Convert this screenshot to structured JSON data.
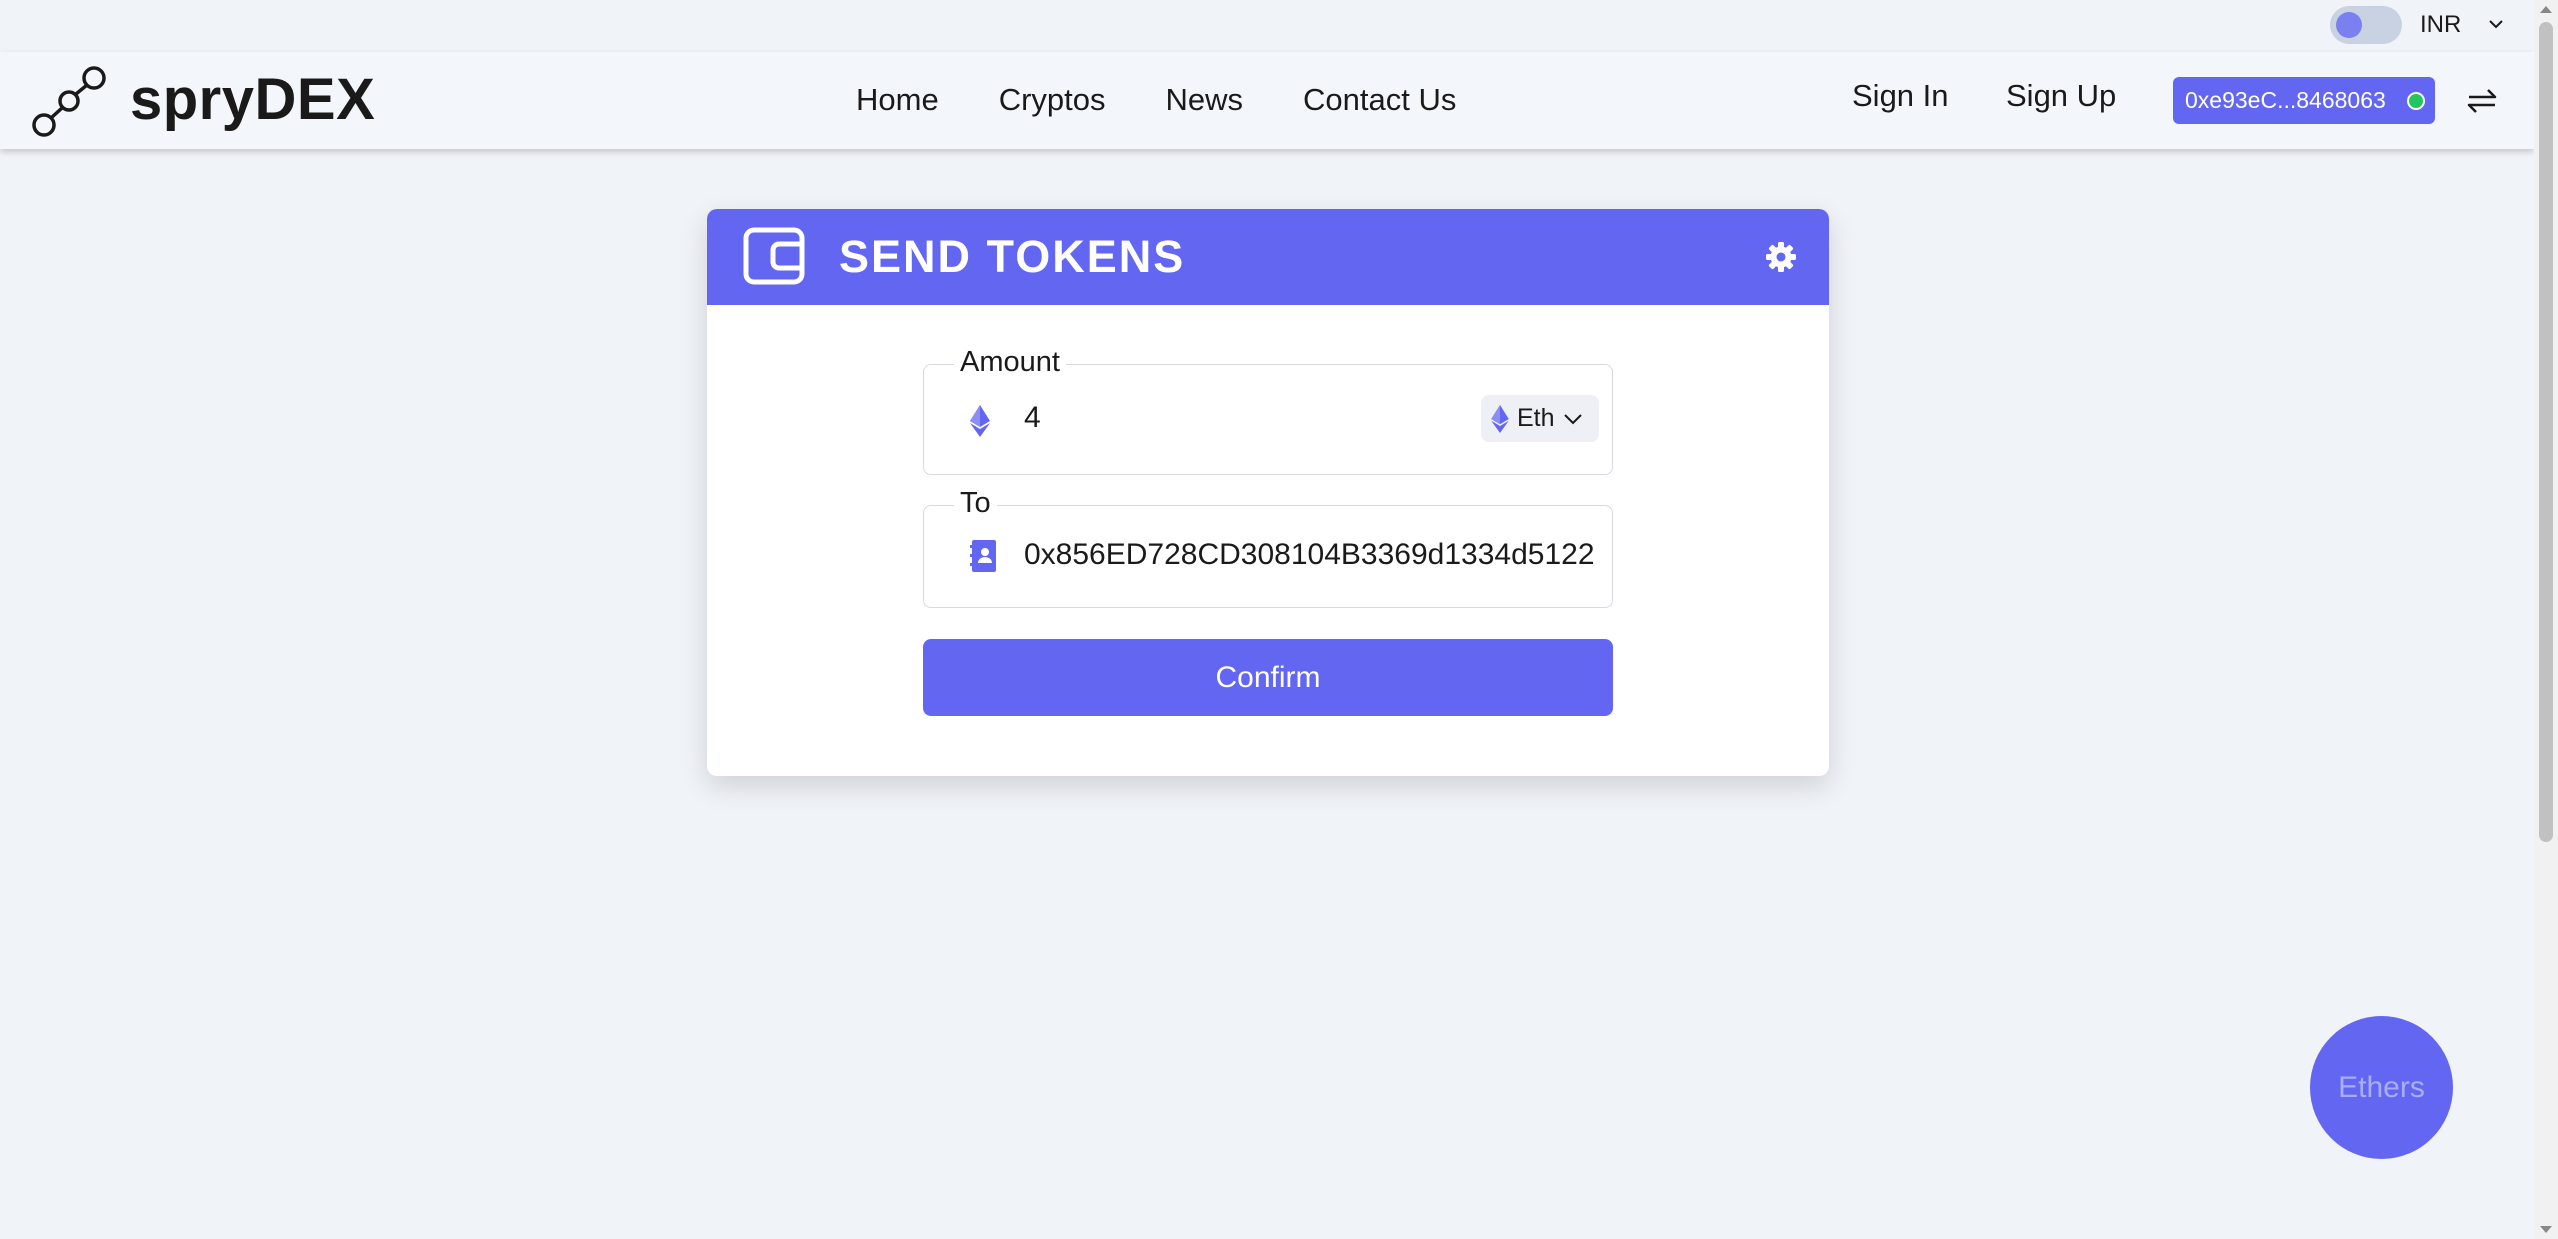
{
  "utility": {
    "currency": "INR",
    "theme_toggle_on": true
  },
  "navbar": {
    "brand": "spryDEX",
    "links": [
      "Home",
      "Cryptos",
      "News",
      "Contact Us"
    ],
    "sign_in": "Sign In",
    "sign_up": "Sign Up",
    "wallet_address": "0xe93eC...8468063",
    "wallet_connected_color": "#22c55e"
  },
  "send_card": {
    "title": "SEND TOKENS",
    "amount": {
      "legend": "Amount",
      "value": "4",
      "token": "Eth"
    },
    "to": {
      "legend": "To",
      "value": "0x856ED728CD308104B3369d1334d5122"
    },
    "confirm_label": "Confirm"
  },
  "floating_button": {
    "label": "Ethers"
  },
  "colors": {
    "accent": "#6366f1",
    "background": "#f0f3f8"
  },
  "icons": {
    "logo": "chain-link-icon",
    "header_wallet": "wallet-icon",
    "settings": "gear-icon",
    "token": "ethereum-icon",
    "contact": "contact-book-icon",
    "swap": "swap-arrows-icon"
  }
}
